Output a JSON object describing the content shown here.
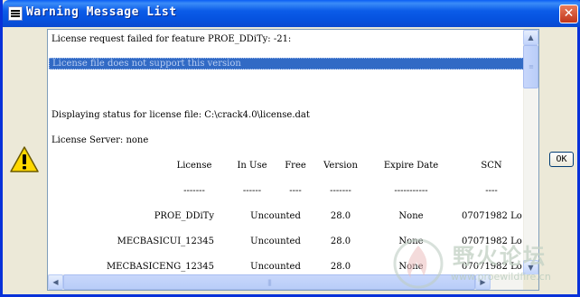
{
  "window": {
    "title": "Warning Message List",
    "close_glyph": "✕",
    "ok_label": "OK"
  },
  "messages": {
    "line1": "License request failed for feature PROE_DDiTy: -21:",
    "line2_selected": "License file does not support this version",
    "line3": "Displaying status for license file: C:\\crack4.0\\license.dat",
    "line4": "License Server: none"
  },
  "table": {
    "headers": [
      "License",
      "In Use",
      "Free",
      "Version",
      "Expire Date",
      "SCN"
    ],
    "separators": [
      "-------",
      "------",
      "----",
      "-------",
      "-----------",
      "----"
    ],
    "rows": [
      {
        "license": "PROE_DDiTy",
        "in_use": "Uncounted",
        "version": "28.0",
        "expire": "None",
        "scn": "07071982 Lo"
      },
      {
        "license": "MECBASICUI_12345",
        "in_use": "Uncounted",
        "version": "28.0",
        "expire": "None",
        "scn": "07071982 Lo"
      },
      {
        "license": "MECBASICENG_12345",
        "in_use": "Uncounted",
        "version": "28.0",
        "expire": "None",
        "scn": "07071982 Lo"
      }
    ]
  },
  "watermark": {
    "text": "野火论坛",
    "url": "www.proewildfire.cn"
  },
  "colors": {
    "titlebar": "#0a5df4",
    "selection": "#316ac5",
    "warning_yellow": "#ffd800"
  }
}
